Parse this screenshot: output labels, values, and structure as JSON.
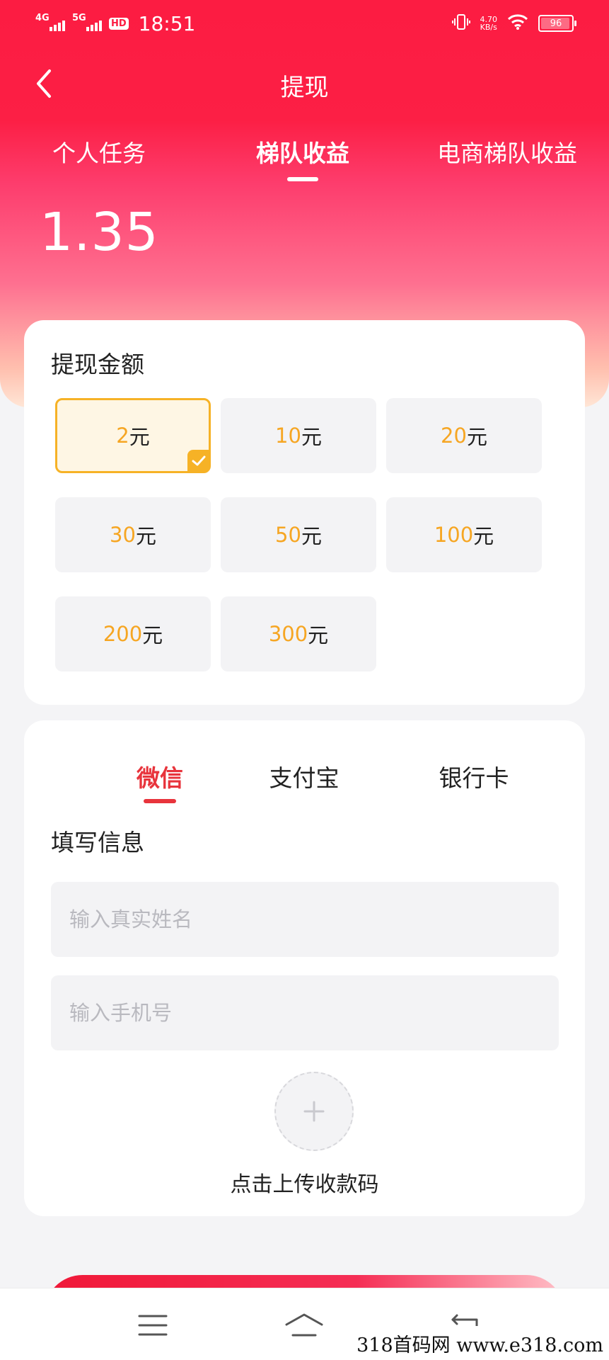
{
  "status_bar": {
    "signal_1": "4G",
    "signal_2": "5G",
    "hd_badge": "HD",
    "time": "18:51",
    "net_speed_value": "4.70",
    "net_speed_unit": "KB/s",
    "battery": "96"
  },
  "header": {
    "title": "提现"
  },
  "top_tabs": {
    "active_index": 1,
    "items": [
      {
        "label": "个人任务"
      },
      {
        "label": "梯队收益"
      },
      {
        "label": "电商梯队收益"
      }
    ]
  },
  "balance": "1.35",
  "amount_section": {
    "title": "提现金额",
    "unit": "元",
    "selected_index": 0,
    "options": [
      {
        "value": "2"
      },
      {
        "value": "10"
      },
      {
        "value": "20"
      },
      {
        "value": "30"
      },
      {
        "value": "50"
      },
      {
        "value": "100"
      },
      {
        "value": "200"
      },
      {
        "value": "300"
      }
    ]
  },
  "payment": {
    "active_index": 0,
    "tabs": [
      {
        "label": "微信"
      },
      {
        "label": "支付宝"
      },
      {
        "label": "银行卡"
      }
    ],
    "form_title": "填写信息",
    "name_field": {
      "value": "",
      "placeholder": "输入真实姓名"
    },
    "phone_field": {
      "value": "",
      "placeholder": "输入手机号"
    },
    "upload_label": "点击上传收款码"
  },
  "watermark": "318首码网 www.e318.com",
  "colors": {
    "brand_red": "#fc1c42",
    "accent_orange": "#f6a623",
    "active_tab_red": "#e8343c"
  },
  "icons": {
    "back": "chevron-left-icon",
    "selected": "check-icon",
    "upload": "plus-icon",
    "sys_menu": "menu-icon",
    "sys_home": "home-icon",
    "sys_back": "return-icon"
  }
}
